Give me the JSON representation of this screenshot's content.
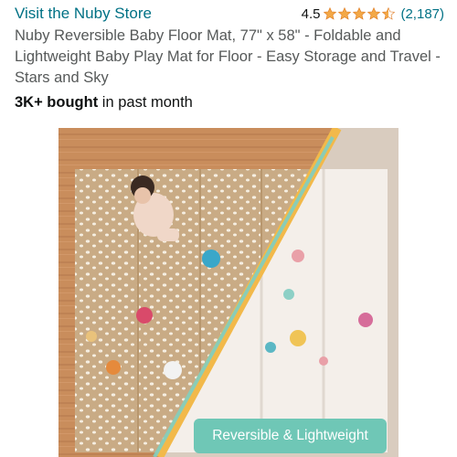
{
  "store": {
    "link_label": "Visit the Nuby Store"
  },
  "rating": {
    "value": "4.5",
    "stars_out_of_5": 4.5,
    "count_label": "(2,187)",
    "star_color": "#f3a847"
  },
  "product": {
    "title": "Nuby Reversible Baby Floor Mat, 77\" x 58\" - Foldable and Lightweight Baby Play Mat for Floor - Easy Storage and Travel - Stars and Sky"
  },
  "bought": {
    "strong": "3K+ bought",
    "rest": " in past month"
  },
  "image": {
    "badge_label": "Reversible & Lightweight",
    "badge_color": "#6fc7b6"
  },
  "colors": {
    "link": "#007185",
    "text": "#0f1111",
    "muted": "#565959"
  }
}
